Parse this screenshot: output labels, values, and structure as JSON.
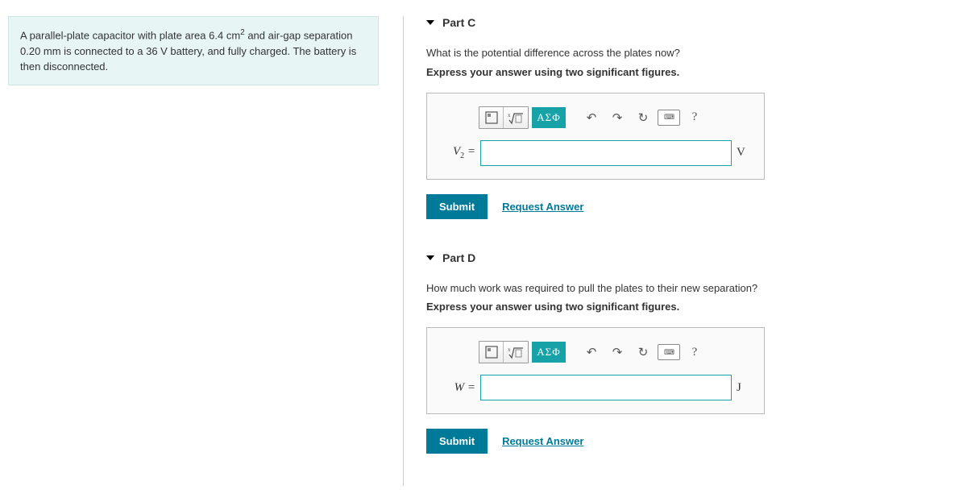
{
  "problem": {
    "text_before_sup": "A parallel-plate capacitor with plate area 6.4 cm",
    "sup": "2",
    "text_mid": " and air-gap separation 0.20 mm is connected to a 36 V battery, and fully charged. The battery is then disconnected."
  },
  "parts": [
    {
      "title": "Part C",
      "question": "What is the potential difference across the plates now?",
      "instruction": "Express your answer using two significant figures.",
      "var_html": "V<sub>2</sub> =",
      "unit": "V",
      "submit": "Submit",
      "request": "Request Answer"
    },
    {
      "title": "Part D",
      "question": "How much work was required to pull the plates to their new separation?",
      "instruction": "Express your answer using two significant figures.",
      "var_html": "W =",
      "unit": "J",
      "submit": "Submit",
      "request": "Request Answer"
    }
  ],
  "toolbar": {
    "greek": "ΑΣΦ",
    "help": "?"
  }
}
